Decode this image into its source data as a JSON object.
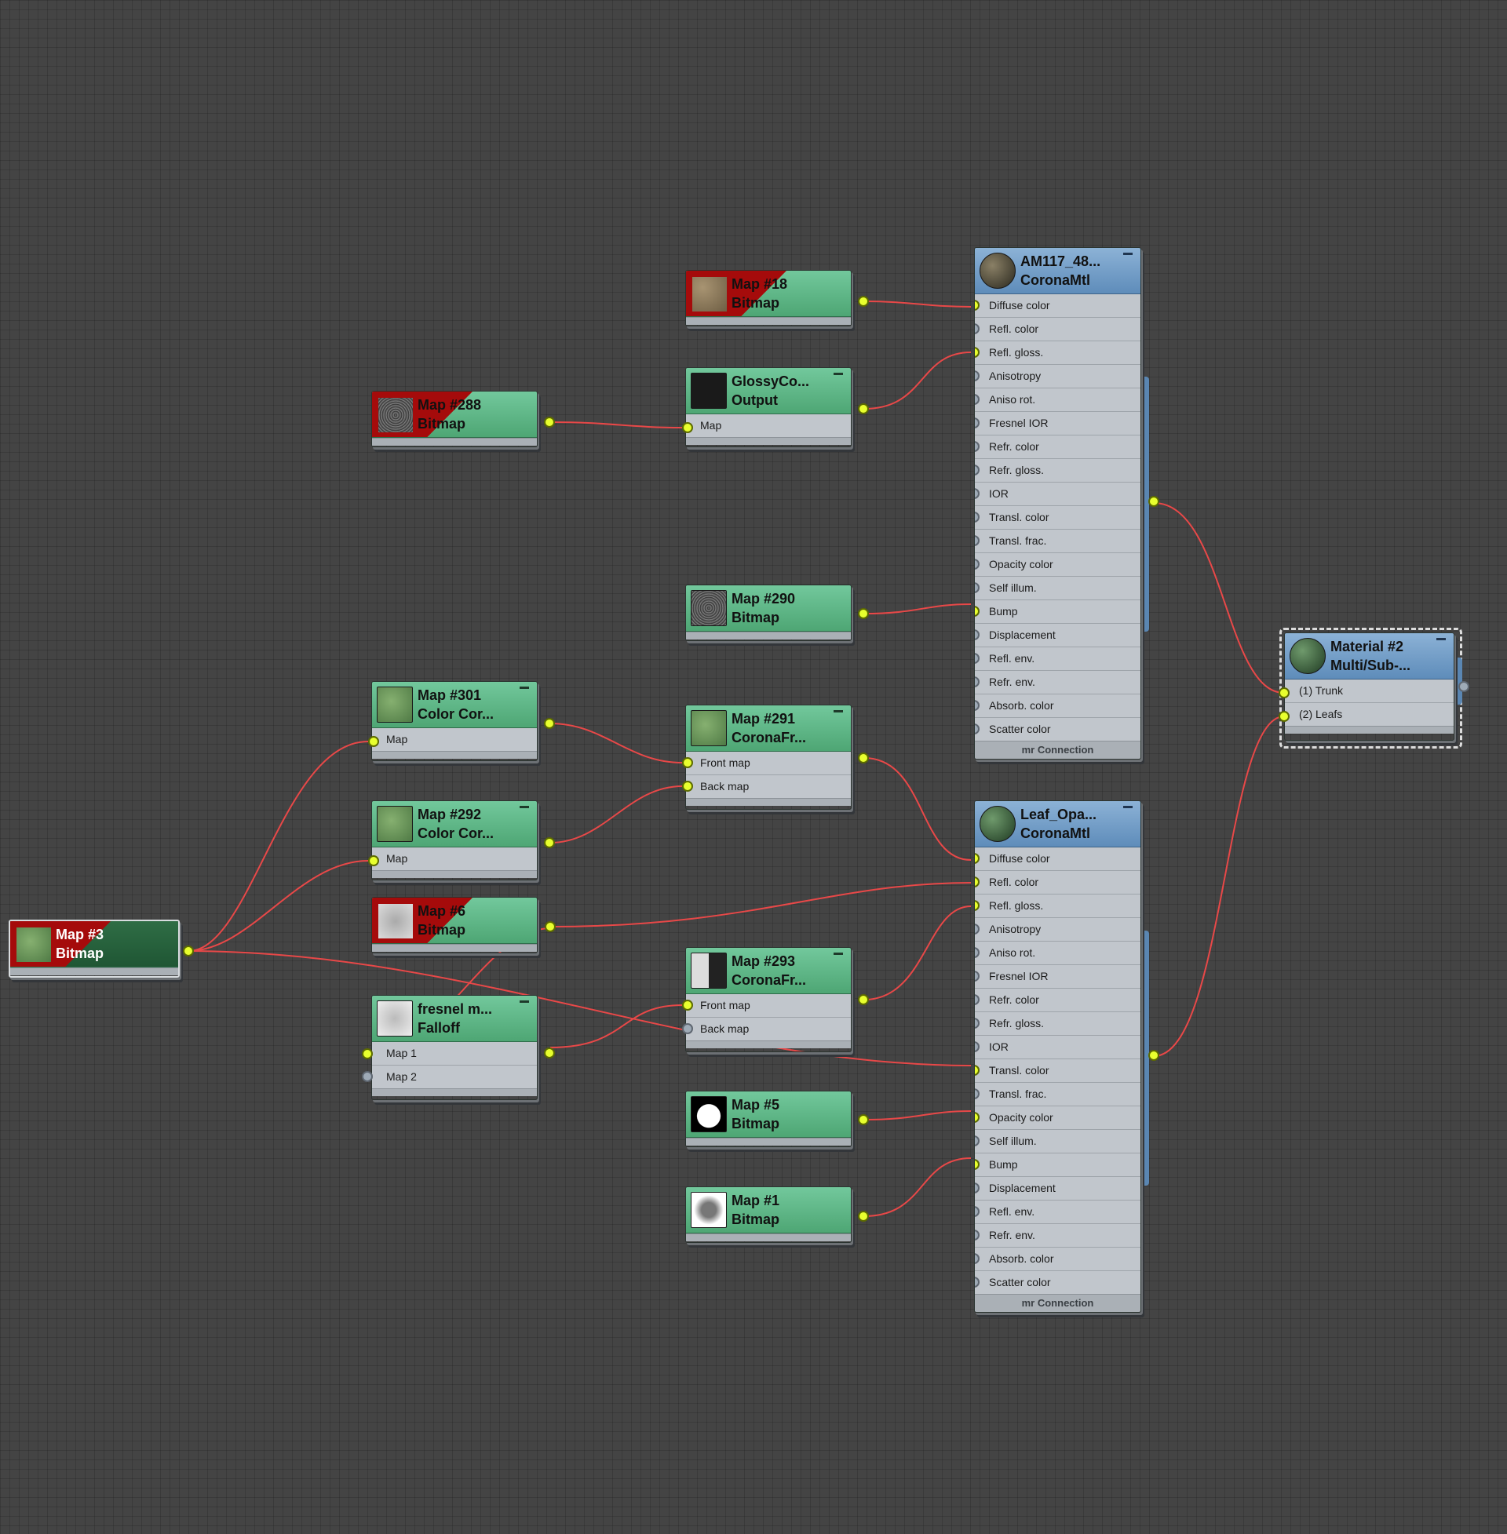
{
  "nodes": {
    "map18": {
      "title": "Map #18",
      "type": "Bitmap",
      "thumb": "stone-texture"
    },
    "glossy": {
      "title": "GlossyCo...",
      "type": "Output",
      "inputs": [
        "Map"
      ],
      "thumb": "black-swatch"
    },
    "map288": {
      "title": "Map #288",
      "type": "Bitmap",
      "thumb": "noise-texture"
    },
    "map290": {
      "title": "Map #290",
      "type": "Bitmap",
      "thumb": "noise-texture"
    },
    "map301": {
      "title": "Map #301",
      "type": "Color Cor...",
      "inputs": [
        "Map"
      ],
      "thumb": "leaf-texture"
    },
    "map292": {
      "title": "Map #292",
      "type": "Color Cor...",
      "inputs": [
        "Map"
      ],
      "thumb": "leaf-texture"
    },
    "map6": {
      "title": "Map #6",
      "type": "Bitmap",
      "thumb": "leaf-grey"
    },
    "map3": {
      "title": "Map #3",
      "type": "Bitmap",
      "thumb": "leaf-texture"
    },
    "fresnel": {
      "title": "fresnel m...",
      "type": "Falloff",
      "inputs": [
        "Map 1",
        "Map 2"
      ],
      "thumb": "leaf-grey"
    },
    "map291": {
      "title": "Map #291",
      "type": "CoronaFr...",
      "inputs": [
        "Front map",
        "Back map"
      ],
      "thumb": "leaf-texture"
    },
    "map293": {
      "title": "Map #293",
      "type": "CoronaFr...",
      "inputs": [
        "Front map",
        "Back map"
      ],
      "thumb": "split-swatch"
    },
    "map5": {
      "title": "Map #5",
      "type": "Bitmap",
      "thumb": "leaf-mask"
    },
    "map1": {
      "title": "Map #1",
      "type": "Bitmap",
      "thumb": "leaf-veins"
    },
    "am117": {
      "title": "AM117_48...",
      "type": "CoronaMtl",
      "footer": "mr Connection",
      "thumb": "sphere-preview"
    },
    "leaf": {
      "title": "Leaf_Opa...",
      "type": "CoronaMtl",
      "footer": "mr Connection",
      "thumb": "sphere-preview"
    },
    "material2": {
      "title": "Material #2",
      "type": "Multi/Sub-...",
      "inputs": [
        "(1) Trunk",
        "(2) Leafs"
      ],
      "thumb": "sphere-preview"
    }
  },
  "corona_inputs": [
    "Diffuse color",
    "Refl. color",
    "Refl. gloss.",
    "Anisotropy",
    "Aniso rot.",
    "Fresnel IOR",
    "Refr. color",
    "Refr. gloss.",
    "IOR",
    "Transl. color",
    "Transl. frac.",
    "Opacity color",
    "Self illum.",
    "Bump",
    "Displacement",
    "Refl. env.",
    "Refr. env.",
    "Absorb. color",
    "Scatter color"
  ],
  "colors": {
    "wire": "#e84848",
    "port_active": "#e8ff2e",
    "node_green": "#5cb384",
    "node_blue": "#6f9bc6",
    "background": "#444444"
  }
}
